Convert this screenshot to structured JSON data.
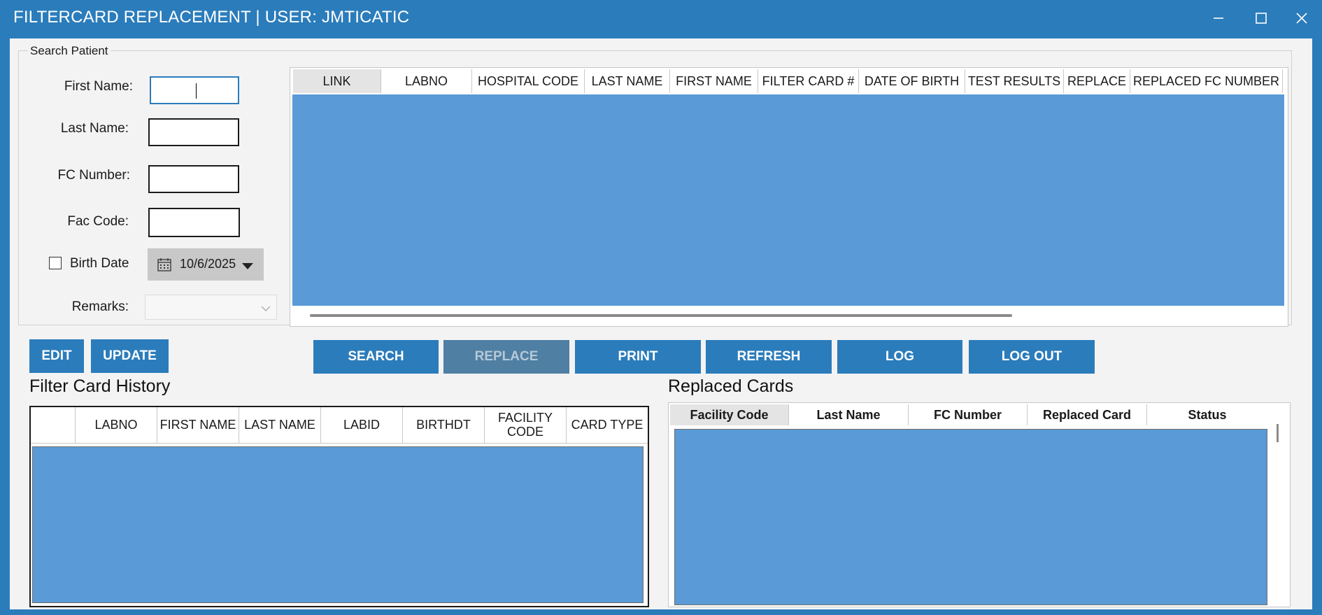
{
  "window": {
    "title": "FILTERCARD REPLACEMENT | USER: JMTICATIC",
    "controls": [
      "minimize-icon",
      "maximize-icon",
      "close-icon"
    ]
  },
  "search_patient": {
    "legend": "Search Patient",
    "first_name": {
      "label": "First Name:",
      "value": ""
    },
    "last_name": {
      "label": "Last Name:",
      "value": ""
    },
    "fc_number": {
      "label": "FC Number:",
      "value": ""
    },
    "fac_code": {
      "label": "Fac Code:",
      "value": ""
    },
    "birth_date": {
      "label": "Birth Date",
      "checked": false,
      "value": "10/6/2025"
    },
    "remarks": {
      "label": "Remarks:",
      "value": ""
    }
  },
  "results_grid": {
    "columns": [
      "LINK",
      "LABNO",
      "HOSPITAL CODE",
      "LAST NAME",
      "FIRST NAME",
      "FILTER CARD #",
      "DATE OF BIRTH",
      "TEST RESULTS",
      "REPLACE",
      "REPLACED FC NUMBER"
    ],
    "rows": []
  },
  "buttons": {
    "edit": "EDIT",
    "update": "UPDATE",
    "search": "SEARCH",
    "replace": "REPLACE",
    "print": "PRINT",
    "refresh": "REFRESH",
    "log": "LOG",
    "logout": "LOG OUT"
  },
  "history": {
    "title": "Filter Card History",
    "columns": [
      "",
      "LABNO",
      "FIRST NAME",
      "LAST NAME",
      "LABID",
      "BIRTHDT",
      "FACILITY CODE",
      "CARD TYPE"
    ],
    "rows": []
  },
  "replaced": {
    "title": "Replaced Cards",
    "columns": [
      "Facility Code",
      "Last Name",
      "FC Number",
      "Replaced Card",
      "Status"
    ],
    "rows": []
  },
  "colors": {
    "accent": "#2b7cbb",
    "grid_body": "#5a9ad6",
    "disabled_button": "#4f7fa3"
  }
}
